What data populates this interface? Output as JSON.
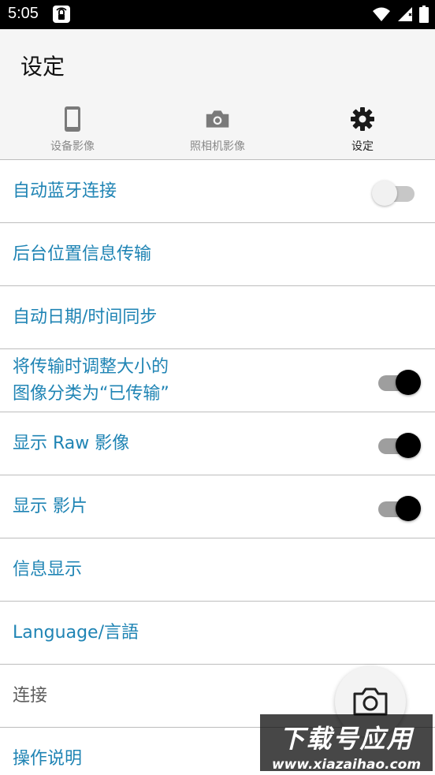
{
  "status_bar": {
    "time": "5:05"
  },
  "app_bar": {
    "title": "设定"
  },
  "tabs": [
    {
      "label": "设备影像",
      "icon": "phone-icon",
      "active": false
    },
    {
      "label": "照相机影像",
      "icon": "camera-icon",
      "active": false
    },
    {
      "label": "设定",
      "icon": "gear-icon",
      "active": true
    }
  ],
  "settings": [
    {
      "label": "自动蓝牙连接",
      "toggle": "off"
    },
    {
      "label": "后台位置信息传输"
    },
    {
      "label": "自动日期/时间同步"
    },
    {
      "label": "将传输时调整大小的\n图像分类为“已传输”",
      "toggle": "on"
    },
    {
      "label": "显示 Raw 影像",
      "toggle": "on"
    },
    {
      "label": "显示 影片",
      "toggle": "on"
    },
    {
      "label": "信息显示"
    },
    {
      "label": "Language/言語"
    },
    {
      "label": "连接",
      "muted": true
    },
    {
      "label": "操作说明"
    }
  ],
  "fab": {
    "icon": "camera-icon"
  },
  "watermark": {
    "title": "下载号应用",
    "url": "www.xiazaihao.com"
  },
  "colors": {
    "accent_text": "#1f84b4",
    "muted_text": "#5d5d5d",
    "toggle_on_thumb": "#000000",
    "app_bar_bg": "#f5f5f5"
  }
}
